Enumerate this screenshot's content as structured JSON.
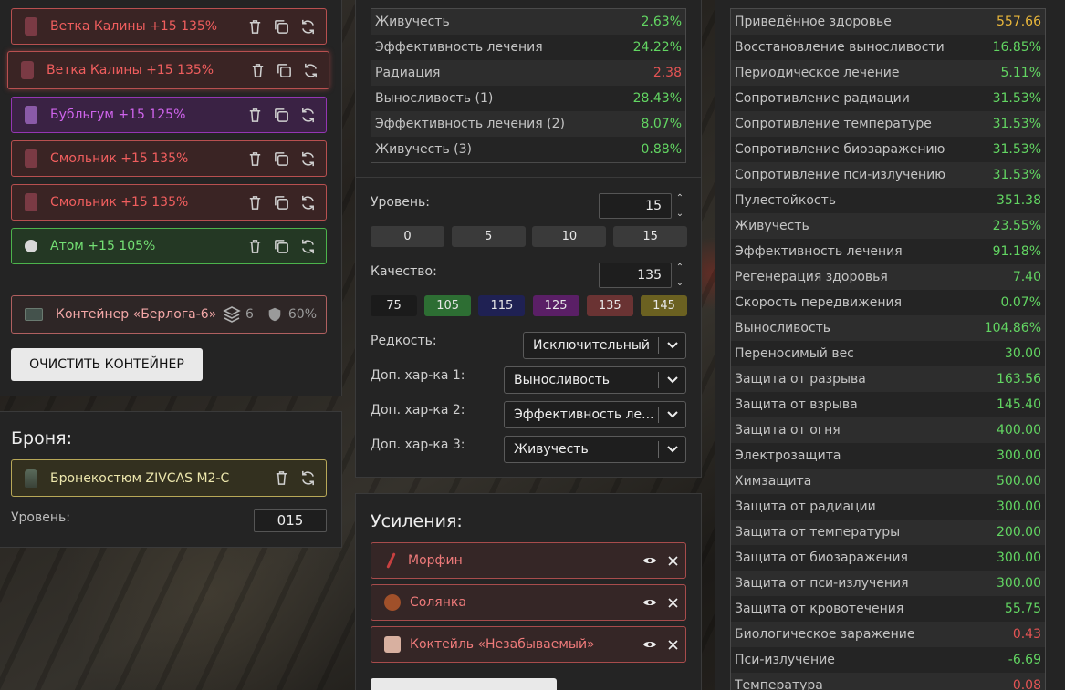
{
  "artifacts": [
    {
      "name": "Ветка Калины +15 135%",
      "tone": "r"
    },
    {
      "name": "Ветка Калины +15 135%",
      "tone": "r"
    },
    {
      "name": "Бубльгум +15 125%",
      "tone": "p"
    },
    {
      "name": "Смольник +15 135%",
      "tone": "r"
    },
    {
      "name": "Смольник +15 135%",
      "tone": "r"
    },
    {
      "name": "Атом +15 105%",
      "tone": "g"
    }
  ],
  "container": {
    "name": "Контейнер «Берлога-6»",
    "slots": "6",
    "protection": "60%",
    "clear_label": "ОЧИСТИТЬ КОНТЕЙНЕР"
  },
  "armor": {
    "title": "Броня:",
    "name": "Бронекостюм ZIVCAS M2-C",
    "level_label": "Уровень:",
    "level_value": "015"
  },
  "artifact_stats": [
    {
      "k": "Живучесть",
      "v": "2.63%",
      "c": "green"
    },
    {
      "k": "Эффективность лечения",
      "v": "24.22%",
      "c": "green"
    },
    {
      "k": "Радиация",
      "v": "2.38",
      "c": "red"
    },
    {
      "k": "Выносливость (1)",
      "v": "28.43%",
      "c": "green"
    },
    {
      "k": "Эффективность лечения (2)",
      "v": "8.07%",
      "c": "green"
    },
    {
      "k": "Живучесть (3)",
      "v": "0.88%",
      "c": "green"
    }
  ],
  "editor": {
    "level_label": "Уровень:",
    "level_value": "15",
    "level_presets": [
      "0",
      "5",
      "10",
      "15"
    ],
    "quality_label": "Качество:",
    "quality_value": "135",
    "quality_presets": [
      "75",
      "105",
      "115",
      "125",
      "135",
      "145"
    ],
    "quality_colors": [
      "#1b1b1b",
      "#2d6e33",
      "#1f2153",
      "#5a1f66",
      "#6a3333",
      "#6b6121"
    ],
    "rarity_label": "Редкость:",
    "rarity_value": "Исключительный",
    "extra1_label": "Доп. хар-ка 1:",
    "extra1_value": "Выносливость",
    "extra2_label": "Доп. хар-ка 2:",
    "extra2_value": "Эффективность ле...",
    "extra3_label": "Доп. хар-ка 3:",
    "extra3_value": "Живучесть"
  },
  "boosts": {
    "title": "Усиления:",
    "items": [
      "Морфин",
      "Солянка",
      "Коктейль «Незабываемый»"
    ]
  },
  "total_stats": [
    {
      "k": "Приведённое здоровье",
      "v": "557.66",
      "c": "orange"
    },
    {
      "k": "Восстановление выносливости",
      "v": "16.85%",
      "c": "green"
    },
    {
      "k": "Периодическое лечение",
      "v": "5.11%",
      "c": "green"
    },
    {
      "k": "Сопротивление радиации",
      "v": "31.53%",
      "c": "green"
    },
    {
      "k": "Сопротивление температуре",
      "v": "31.53%",
      "c": "green"
    },
    {
      "k": "Сопротивление биозаражению",
      "v": "31.53%",
      "c": "green"
    },
    {
      "k": "Сопротивление пси-излучению",
      "v": "31.53%",
      "c": "green"
    },
    {
      "k": "Пулестойкость",
      "v": "351.38",
      "c": "green"
    },
    {
      "k": "Живучесть",
      "v": "23.55%",
      "c": "green"
    },
    {
      "k": "Эффективность лечения",
      "v": "91.18%",
      "c": "green"
    },
    {
      "k": "Регенерация здоровья",
      "v": "7.40",
      "c": "green"
    },
    {
      "k": "Скорость передвижения",
      "v": "0.07%",
      "c": "green"
    },
    {
      "k": "Выносливость",
      "v": "104.86%",
      "c": "green"
    },
    {
      "k": "Переносимый вес",
      "v": "30.00",
      "c": "green"
    },
    {
      "k": "Защита от разрыва",
      "v": "163.56",
      "c": "green"
    },
    {
      "k": "Защита от взрыва",
      "v": "145.40",
      "c": "green"
    },
    {
      "k": "Защита от огня",
      "v": "400.00",
      "c": "green"
    },
    {
      "k": "Электрозащита",
      "v": "300.00",
      "c": "green"
    },
    {
      "k": "Химзащита",
      "v": "500.00",
      "c": "green"
    },
    {
      "k": "Защита от радиации",
      "v": "300.00",
      "c": "green"
    },
    {
      "k": "Защита от температуры",
      "v": "200.00",
      "c": "green"
    },
    {
      "k": "Защита от биозаражения",
      "v": "300.00",
      "c": "green"
    },
    {
      "k": "Защита от пси-излучения",
      "v": "300.00",
      "c": "green"
    },
    {
      "k": "Защита от кровотечения",
      "v": "55.75",
      "c": "green"
    },
    {
      "k": "Биологическое заражение",
      "v": "0.43",
      "c": "red"
    },
    {
      "k": "Пси-излучение",
      "v": "-6.69",
      "c": "green"
    },
    {
      "k": "Температура",
      "v": "0.08",
      "c": "red"
    }
  ]
}
